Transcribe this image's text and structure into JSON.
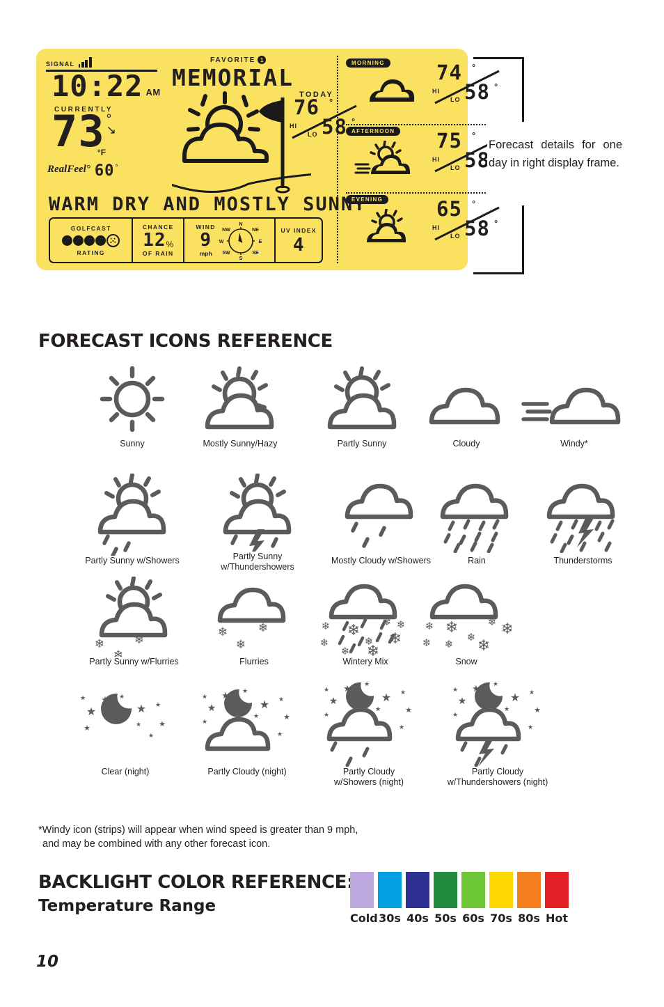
{
  "lcd": {
    "signal_label": "SIGNAL",
    "time": "10:22",
    "ampm": "AM",
    "currently_label": "CURRENTLY",
    "current_temp": "73",
    "current_unit": "°F",
    "realfeel_label": "RealFeel°",
    "realfeel_value": "60",
    "favorite_label": "FAVORITE",
    "favorite_number": "1",
    "course_name": "MEMORIAL",
    "today_label": "TODAY",
    "today_hi": "76",
    "today_lo": "58",
    "hi_tag": "HI",
    "lo_tag": "LO",
    "banner": "WARM DRY AND MOSTLY SUNNY",
    "info": {
      "golfcast_title": "GOLFCAST",
      "golfcast_sub": "RATING",
      "golfcast_filled": 4,
      "golfcast_total": 5,
      "chance_title": "CHANCE",
      "chance_sub": "OF RAIN",
      "chance_value": "12",
      "chance_unit": "%",
      "wind_title": "WIND",
      "wind_value": "9",
      "wind_unit": "mph",
      "compass": [
        "N",
        "NE",
        "E",
        "SE",
        "S",
        "SW",
        "W",
        "NW"
      ],
      "uv_title": "UV INDEX",
      "uv_value": "4"
    },
    "periods": [
      {
        "tag": "MORNING",
        "icon": "cloudy",
        "hi": "74",
        "lo": "58"
      },
      {
        "tag": "AFTERNOON",
        "icon": "partly-windy",
        "hi": "75",
        "lo": "58"
      },
      {
        "tag": "EVENING",
        "icon": "partly-sunny",
        "hi": "65",
        "lo": "58"
      }
    ],
    "background_color": "#fae15f",
    "ink_color": "#1a1a1a"
  },
  "callout": {
    "text": "Forecast details for one day in right display frame."
  },
  "forecast_section": {
    "heading": "FORECAST ICONS REFERENCE",
    "rows": [
      [
        {
          "icon": "sunny",
          "label": "Sunny"
        },
        {
          "icon": "mostly-sunny-hazy",
          "label": "Mostly Sunny/Hazy"
        },
        {
          "icon": "partly-sunny",
          "label": "Partly Sunny"
        },
        {
          "icon": "cloudy",
          "label": "Cloudy"
        },
        {
          "icon": "windy",
          "label": "Windy*"
        }
      ],
      [
        {
          "icon": "partly-sunny-showers",
          "label": "Partly Sunny w/Showers"
        },
        {
          "icon": "partly-sunny-thundershowers",
          "label": "Partly Sunny\nw/Thundershowers"
        },
        {
          "icon": "mostly-cloudy-showers",
          "label": "Mostly Cloudy w/Showers"
        },
        {
          "icon": "rain",
          "label": "Rain"
        },
        {
          "icon": "thunderstorms",
          "label": "Thunderstorms"
        }
      ],
      [
        {
          "icon": "partly-sunny-flurries",
          "label": "Partly Sunny w/Flurries"
        },
        {
          "icon": "flurries",
          "label": "Flurries"
        },
        {
          "icon": "wintery-mix",
          "label": "Wintery Mix"
        },
        {
          "icon": "snow",
          "label": "Snow"
        }
      ],
      [
        {
          "icon": "clear-night",
          "label": "Clear (night)"
        },
        {
          "icon": "partly-cloudy-night",
          "label": "Partly Cloudy (night)"
        },
        {
          "icon": "partly-cloudy-showers-night",
          "label": "Partly Cloudy\nw/Showers (night)"
        },
        {
          "icon": "partly-cloudy-thundershowers-night",
          "label": "Partly Cloudy\nw/Thundershowers (night)"
        }
      ]
    ]
  },
  "footnote": {
    "line1": "*Windy icon (strips) will appear when wind speed is greater than 9 mph,",
    "line2": "and may be combined with any other forecast icon."
  },
  "backlight": {
    "heading": "BACKLIGHT COLOR REFERENCE:",
    "subheading": "Temperature Range",
    "swatches": [
      {
        "label": "Cold",
        "color": "#bda9de"
      },
      {
        "label": "30s",
        "color": "#00a0e3"
      },
      {
        "label": "40s",
        "color": "#2e3192"
      },
      {
        "label": "50s",
        "color": "#228b3c"
      },
      {
        "label": "60s",
        "color": "#6cc635"
      },
      {
        "label": "70s",
        "color": "#fdd700"
      },
      {
        "label": "80s",
        "color": "#f57e1f"
      },
      {
        "label": "Hot",
        "color": "#e41f26"
      }
    ]
  },
  "page_number": "10"
}
